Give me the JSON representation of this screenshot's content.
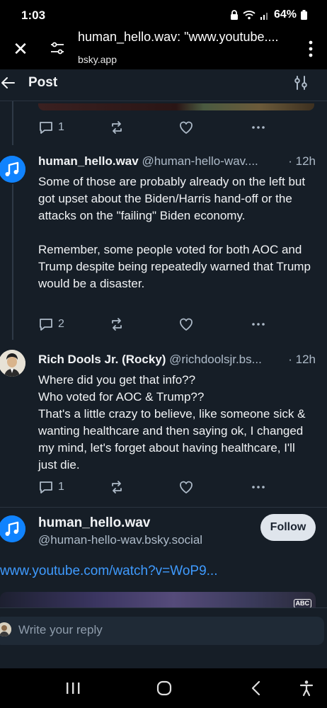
{
  "status_bar": {
    "time": "1:03",
    "battery": "64%"
  },
  "browser": {
    "title": "human_hello.wav: \"www.youtube....",
    "domain": "bsky.app"
  },
  "header": {
    "title": "Post"
  },
  "posts": [
    {
      "display_name": "human_hello.wav",
      "handle": "@human-hello-wav....",
      "time": "· 12h",
      "text": [
        "Some of those are probably already on the left but got upset about the Biden/Harris hand-off or the attacks on the \"failing\" Biden economy.",
        "Remember, some people voted for both AOC and Trump despite being repeatedly warned that Trump would be a disaster."
      ],
      "reply_count": "2"
    },
    {
      "display_name": "Rich Dools Jr. (Rocky)",
      "handle": "@richdoolsjr.bs...",
      "time": "· 12h",
      "text": [
        "Where did you get that info??",
        "Who voted for AOC & Trump??",
        "That's a little crazy to believe, like someone sick & wanting healthcare and then saying ok, I changed my mind, let's forget about having healthcare, I'll just die."
      ],
      "reply_count": "1"
    }
  ],
  "top_actions": {
    "reply_count": "1"
  },
  "main_post": {
    "display_name": "human_hello.wav",
    "handle": "@human-hello-wav.bsky.social",
    "follow_label": "Follow",
    "link": "www.youtube.com/watch?v=WoP9...",
    "embed_badge": "ABC"
  },
  "composer": {
    "placeholder": "Write your reply"
  },
  "colors": {
    "accent": "#1083fe",
    "link": "#3f9bff",
    "background": "#161e27"
  }
}
